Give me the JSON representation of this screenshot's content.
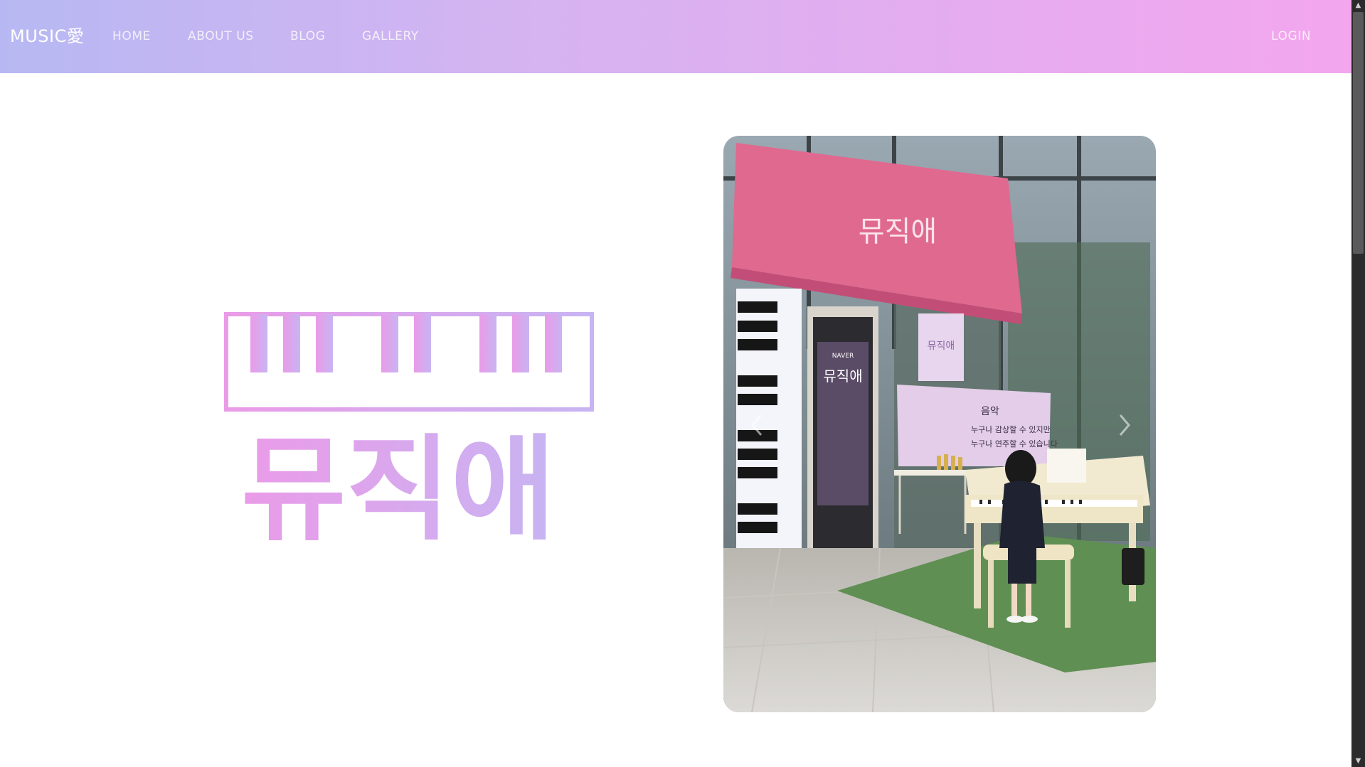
{
  "brand": {
    "label": "MUSIC愛"
  },
  "nav": {
    "items": [
      {
        "label": "HOME"
      },
      {
        "label": "ABOUT US"
      },
      {
        "label": "BLOG"
      },
      {
        "label": "GALLERY"
      }
    ],
    "login_label": "LOGIN"
  },
  "hero": {
    "logo_text": "뮤직애"
  },
  "photo": {
    "awning_text": "뮤직애",
    "door_sign_title": "뮤직애",
    "door_sign_brand": "NAVER",
    "poster_title": "뮤직애",
    "banner_heading": "음악",
    "banner_line1": "누구나 감상할 수 있지만",
    "banner_line2": "누구나 연주할 수 있습니다"
  },
  "colors": {
    "nav_gradient_start": "#b7b8f3",
    "nav_gradient_end": "#f3a6ee",
    "logo_pink": "#ea9be8",
    "logo_lavender": "#c8b4f2"
  },
  "icons": {
    "prev": "chevron-left-icon",
    "next": "chevron-right-icon",
    "scroll_up": "triangle-up-icon",
    "scroll_down": "triangle-down-icon"
  }
}
